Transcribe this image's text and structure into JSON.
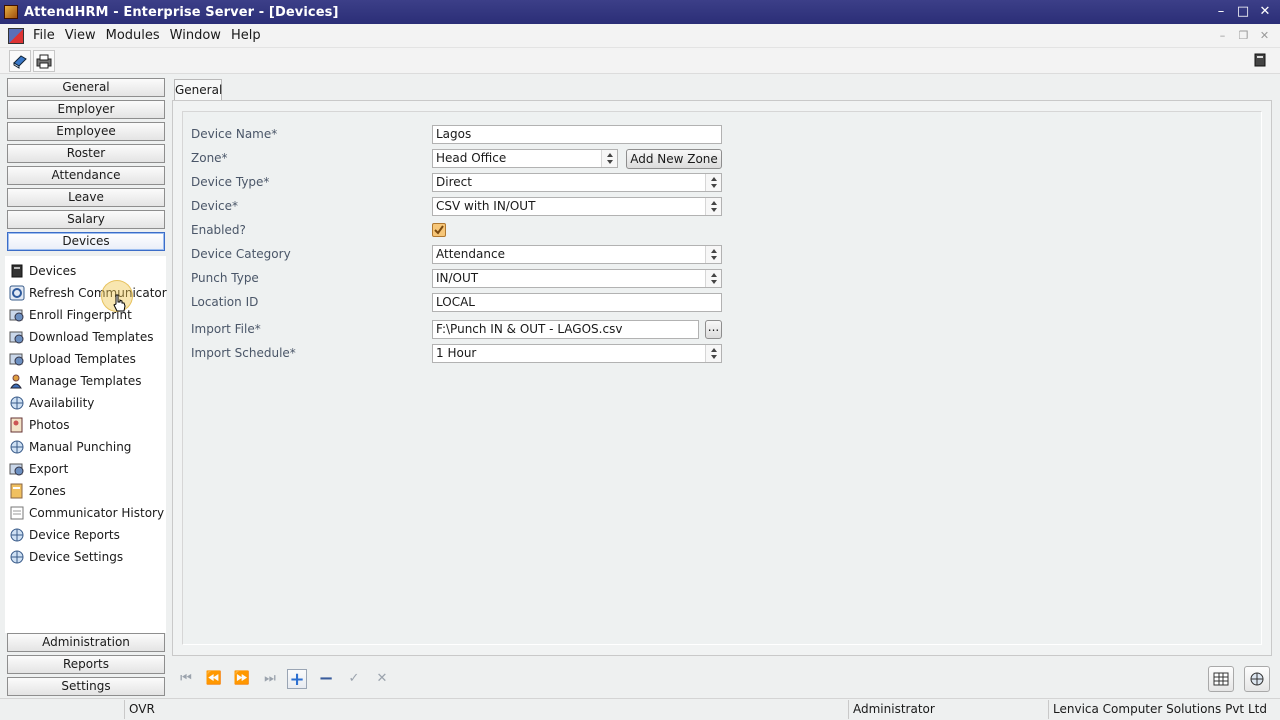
{
  "window": {
    "title": "AttendHRM - Enterprise Server - [Devices]",
    "minimize": "–",
    "maximize": "□",
    "close": "✕"
  },
  "menu": {
    "items": [
      "File",
      "View",
      "Modules",
      "Window",
      "Help"
    ],
    "mdi": [
      "–",
      "❐",
      "✕"
    ]
  },
  "nav": {
    "top": [
      "General",
      "Employer",
      "Employee",
      "Roster",
      "Attendance",
      "Leave",
      "Salary",
      "Devices"
    ],
    "active": "Devices",
    "bottom": [
      "Administration",
      "Reports",
      "Settings"
    ]
  },
  "sub_menu": [
    {
      "label": "Devices",
      "icon": "device-book-icon"
    },
    {
      "label": "Refresh Communicator",
      "icon": "refresh-icon"
    },
    {
      "label": "Enroll Fingerprint",
      "icon": "fingerprint-icon"
    },
    {
      "label": "Download Templates",
      "icon": "download-icon"
    },
    {
      "label": "Upload Templates",
      "icon": "upload-icon"
    },
    {
      "label": "Manage Templates",
      "icon": "user-manage-icon"
    },
    {
      "label": "Availability",
      "icon": "globe-icon"
    },
    {
      "label": "Photos",
      "icon": "photo-icon"
    },
    {
      "label": "Manual Punching",
      "icon": "globe-icon"
    },
    {
      "label": "Export",
      "icon": "export-icon"
    },
    {
      "label": "Zones",
      "icon": "zones-icon"
    },
    {
      "label": "Communicator History",
      "icon": "history-icon"
    },
    {
      "label": "Device Reports",
      "icon": "globe-icon"
    },
    {
      "label": "Device Settings",
      "icon": "globe-icon"
    }
  ],
  "tab": {
    "label": "General"
  },
  "form": {
    "device_name": {
      "label": "Device Name*",
      "value": "Lagos"
    },
    "zone": {
      "label": "Zone*",
      "value": "Head Office",
      "add_button": "Add New Zone"
    },
    "device_type": {
      "label": "Device Type*",
      "value": "Direct"
    },
    "device": {
      "label": "Device*",
      "value": "CSV with IN/OUT"
    },
    "enabled": {
      "label": "Enabled?",
      "checked": true
    },
    "device_category": {
      "label": "Device Category",
      "value": "Attendance"
    },
    "punch_type": {
      "label": "Punch Type",
      "value": "IN/OUT"
    },
    "location_id": {
      "label": "Location ID",
      "value": "LOCAL"
    },
    "import_file": {
      "label": "Import File*",
      "value": "F:\\Punch IN & OUT - LAGOS.csv",
      "browse": "..."
    },
    "import_schedule": {
      "label": "Import Schedule*",
      "value": "1 Hour"
    }
  },
  "record_nav": {
    "first": "⏮",
    "prev": "⏪",
    "next": "⏩",
    "last": "⏭",
    "add": "+",
    "delete": "−",
    "save": "✓",
    "cancel": "✕"
  },
  "status": {
    "mode": "OVR",
    "user": "Administrator",
    "company": "Lenvica Computer Solutions Pvt Ltd"
  },
  "colors": {
    "titlebar": "#2f3280",
    "accent": "#3c6dc8",
    "checkbox": "#f6c678"
  }
}
